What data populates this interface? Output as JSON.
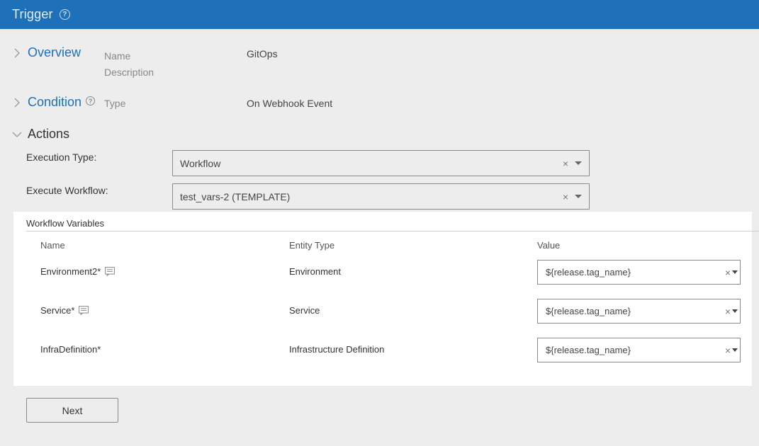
{
  "header": {
    "title": "Trigger"
  },
  "overview": {
    "title": "Overview",
    "name_label": "Name",
    "name_value": "GitOps",
    "description_label": "Description"
  },
  "condition": {
    "title": "Condition",
    "type_label": "Type",
    "type_value": "On Webhook Event"
  },
  "actions": {
    "title": "Actions",
    "execution_type_label": "Execution Type:",
    "execution_type_value": "Workflow",
    "execute_workflow_label": "Execute Workflow:",
    "execute_workflow_value": "test_vars-2 (TEMPLATE)"
  },
  "workflow_variables": {
    "title": "Workflow Variables",
    "columns": [
      "Name",
      "Entity Type",
      "Value"
    ],
    "rows": [
      {
        "name": "Environment2*",
        "entity_type": "Environment",
        "value": "${release.tag_name}"
      },
      {
        "name": "Service*",
        "entity_type": "Service",
        "value": "${release.tag_name}"
      },
      {
        "name": "InfraDefinition*",
        "entity_type": "Infrastructure Definition",
        "value": "${release.tag_name}"
      }
    ]
  },
  "footer": {
    "next_label": "Next"
  },
  "colors": {
    "header_bg": "#1e71b8",
    "accent": "#1e71b8",
    "page_bg": "#ededed"
  }
}
